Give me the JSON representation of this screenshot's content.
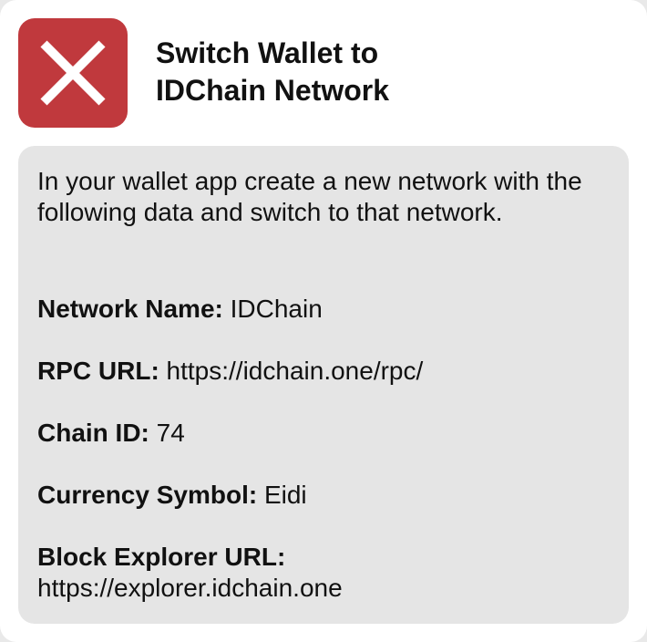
{
  "dialog": {
    "title_line1": "Switch Wallet to",
    "title_line2": "IDChain Network",
    "status_icon": "close-x-icon",
    "status_color": "#c0393d",
    "instructions": "In your wallet app create a new network with the following data and switch to that network.",
    "fields": [
      {
        "label": "Network Name:",
        "value": "IDChain"
      },
      {
        "label": "RPC URL:",
        "value": "https://idchain.one/rpc/"
      },
      {
        "label": "Chain ID:",
        "value": "74"
      },
      {
        "label": "Currency Symbol:",
        "value": "Eidi"
      },
      {
        "label": "Block Explorer URL:",
        "value": "https://explorer.idchain.one"
      }
    ]
  }
}
